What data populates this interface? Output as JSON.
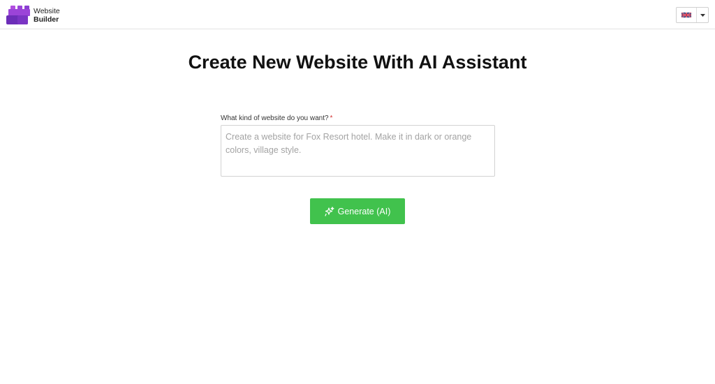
{
  "header": {
    "logo": {
      "line1": "Website",
      "line2": "Builder",
      "icon": "brick-logo-icon",
      "color": "#8a3fd1"
    },
    "language": {
      "selected": "English",
      "flag_icon": "uk-flag-icon",
      "caret_icon": "caret-down-icon"
    }
  },
  "main": {
    "title": "Create New Website With AI Assistant",
    "prompt": {
      "label": "What kind of website do you want?",
      "required_marker": "*",
      "placeholder": "Create a website for Fox Resort hotel. Make it in dark or orange colors, village style.",
      "value": ""
    },
    "generate_button": {
      "label": "Generate (AI)",
      "icon": "sparkle-icon",
      "color": "#41c24d"
    }
  }
}
